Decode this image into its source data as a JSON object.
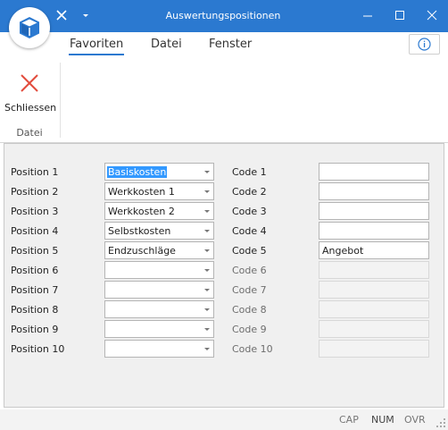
{
  "window": {
    "title": "Auswertungspositionen"
  },
  "colors": {
    "accent": "#2b79d0",
    "close_icon": "#e24b3c",
    "selection": "#3399ff"
  },
  "ribbon": {
    "tabs": [
      {
        "label": "Favoriten",
        "active": true
      },
      {
        "label": "Datei",
        "active": false
      },
      {
        "label": "Fenster",
        "active": false
      }
    ],
    "close_button_label": "Schliessen",
    "group_label": "Datei"
  },
  "positions": [
    {
      "label": "Position 1",
      "value": "Basiskosten"
    },
    {
      "label": "Position 2",
      "value": "Werkkosten 1"
    },
    {
      "label": "Position 3",
      "value": "Werkkosten 2"
    },
    {
      "label": "Position 4",
      "value": "Selbstkosten"
    },
    {
      "label": "Position 5",
      "value": "Endzuschläge"
    },
    {
      "label": "Position 6",
      "value": ""
    },
    {
      "label": "Position 7",
      "value": ""
    },
    {
      "label": "Position 8",
      "value": ""
    },
    {
      "label": "Position 9",
      "value": ""
    },
    {
      "label": "Position 10",
      "value": ""
    }
  ],
  "codes": [
    {
      "label": "Code 1",
      "value": "",
      "enabled": true
    },
    {
      "label": "Code 2",
      "value": "",
      "enabled": true
    },
    {
      "label": "Code 3",
      "value": "",
      "enabled": true
    },
    {
      "label": "Code 4",
      "value": "",
      "enabled": true
    },
    {
      "label": "Code 5",
      "value": "Angebot",
      "enabled": true
    },
    {
      "label": "Code 6",
      "value": "",
      "enabled": false
    },
    {
      "label": "Code 7",
      "value": "",
      "enabled": false
    },
    {
      "label": "Code 8",
      "value": "",
      "enabled": false
    },
    {
      "label": "Code 9",
      "value": "",
      "enabled": false
    },
    {
      "label": "Code 10",
      "value": "",
      "enabled": false
    }
  ],
  "status": {
    "cap": "CAP",
    "num": "NUM",
    "ovr": "OVR"
  }
}
